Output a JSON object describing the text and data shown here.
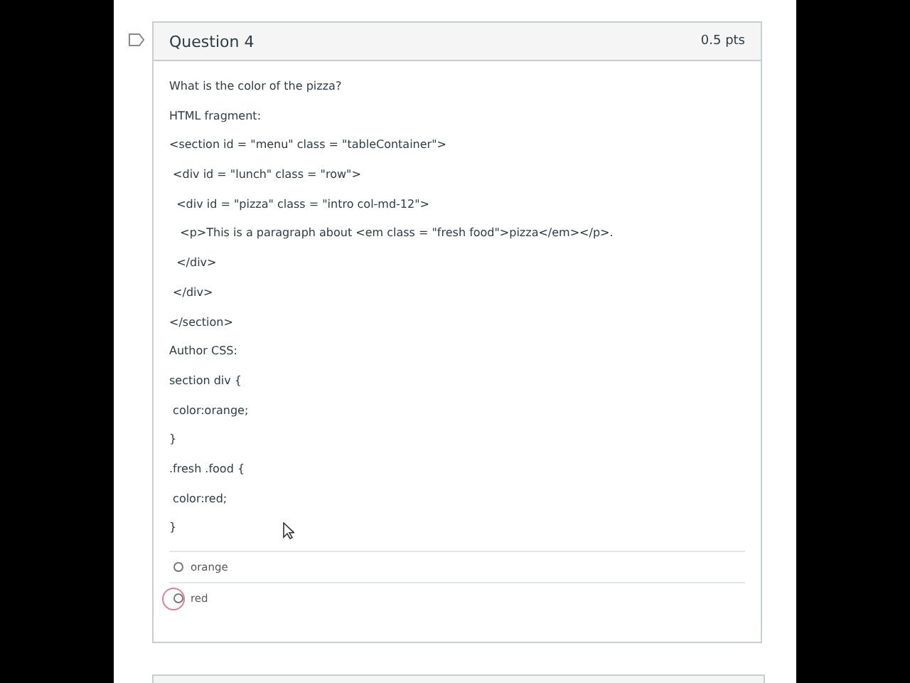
{
  "question": {
    "title": "Question 4",
    "points": "0.5 pts",
    "lines": [
      "What is the color of the pizza?",
      "HTML fragment:",
      "<section id = \"menu\" class = \"tableContainer\">",
      " <div id = \"lunch\" class = \"row\">",
      "  <div id = \"pizza\" class = \"intro col-md-12\">",
      "   <p>This is a paragraph about <em class = \"fresh food\">pizza</em></p>.",
      "  </div>",
      " </div>",
      "</section>",
      "Author CSS:",
      "section div {",
      " color:orange;",
      "}",
      ".fresh .food {",
      " color:red;",
      "}"
    ],
    "answers": [
      {
        "label": "orange",
        "selected": false
      },
      {
        "label": "red",
        "selected": false
      }
    ]
  }
}
